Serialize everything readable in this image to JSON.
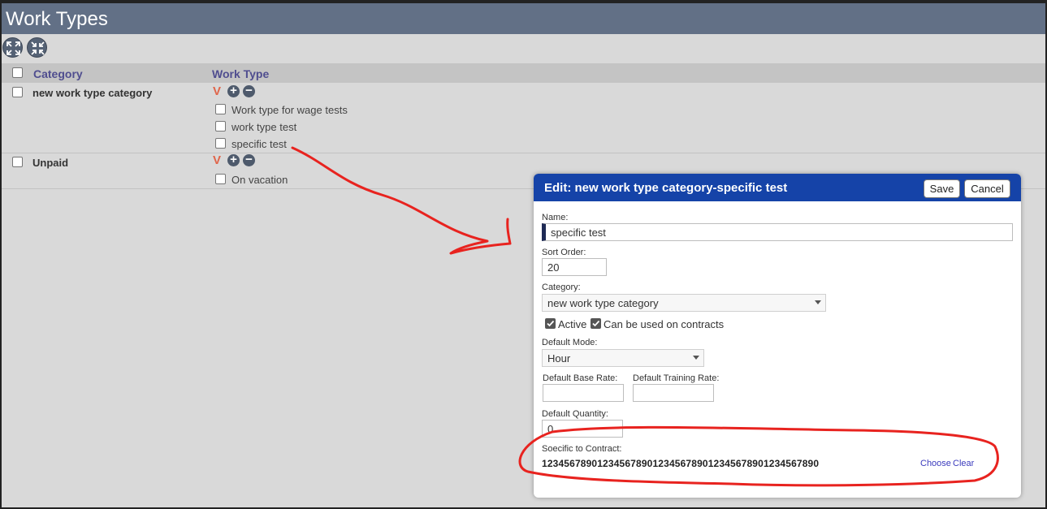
{
  "page": {
    "title": "Work Types"
  },
  "toolbar": {
    "expand_icon": "expand-all-icon",
    "collapse_icon": "collapse-all-icon"
  },
  "grid": {
    "headers": {
      "category": "Category",
      "work_type": "Work Type"
    },
    "categories": [
      {
        "name": "new work type category",
        "work_types": [
          "Work type for wage tests",
          "work type test",
          "specific test"
        ]
      },
      {
        "name": "Unpaid",
        "work_types": [
          "On vacation"
        ]
      }
    ],
    "row_actions": {
      "expand_mark": "V",
      "add": "+",
      "remove": "−"
    }
  },
  "dialog": {
    "title": "Edit: new work type category-specific test",
    "save_label": "Save",
    "cancel_label": "Cancel",
    "name": {
      "label": "Name:",
      "value": "specific test"
    },
    "sort_order": {
      "label": "Sort Order:",
      "value": "20"
    },
    "category": {
      "label": "Category:",
      "value": "new work type category"
    },
    "active_label": "Active",
    "contracts_label": "Can be used on contracts",
    "default_mode": {
      "label": "Default Mode:",
      "value": "Hour"
    },
    "base_rate": {
      "label": "Default Base Rate:",
      "value": ""
    },
    "training_rate": {
      "label": "Default Training Rate:",
      "value": ""
    },
    "quantity": {
      "label": "Default Quantity:",
      "value": "0"
    },
    "specific_contract": {
      "label": "Soecific to Contract:",
      "value": "12345678901234567890123456789012345678901234567890",
      "choose": "Choose",
      "clear": "Clear"
    }
  },
  "colors": {
    "title_bar": "#627086",
    "dialog_header": "#1543a8",
    "annotation": "#e8231f",
    "header_text": "#4f4d8f"
  }
}
